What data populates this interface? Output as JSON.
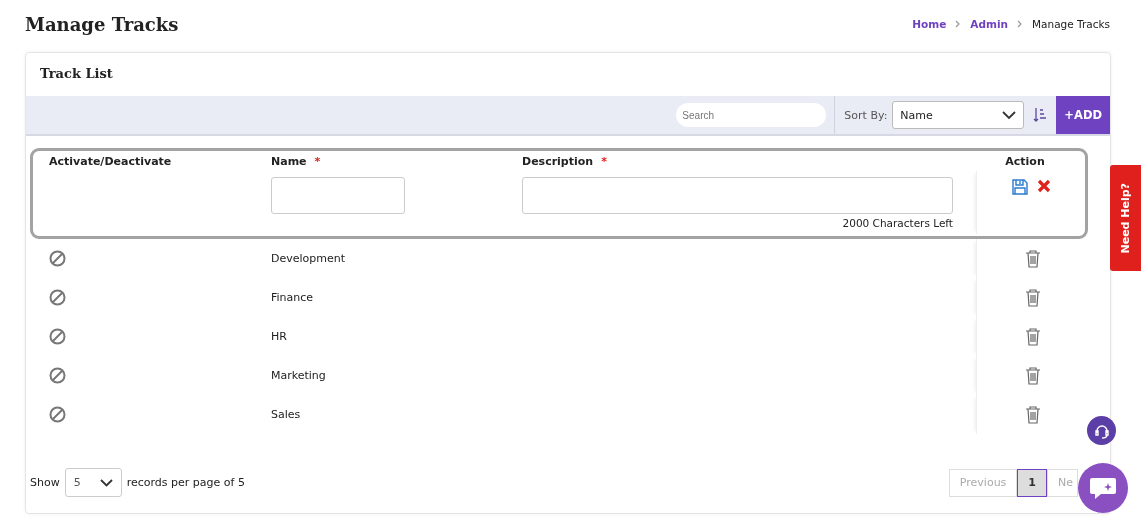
{
  "page_title": "Manage Tracks",
  "breadcrumb": [
    {
      "label": "Home",
      "current": false
    },
    {
      "label": "Admin",
      "current": false
    },
    {
      "label": "Manage Tracks",
      "current": true
    }
  ],
  "card_title": "Track List",
  "toolbar": {
    "search": {
      "placeholder": "Search"
    },
    "sort_label": "Sort By:",
    "sort_value": "Name",
    "add_button": "+ADD"
  },
  "columns": [
    {
      "label": "Activate/Deactivate"
    },
    {
      "label": "Name",
      "required_mark": "*"
    },
    {
      "label": "Description",
      "required_mark": "*"
    },
    {
      "label": "Action"
    }
  ],
  "new_row": {
    "chars_left": "2000 Characters Left"
  },
  "rows": [
    {
      "name": "Development"
    },
    {
      "name": "Finance"
    },
    {
      "name": "HR"
    },
    {
      "name": "Marketing"
    },
    {
      "name": "Sales"
    }
  ],
  "footer": {
    "show_label": "Show",
    "page_size": "5",
    "records_text": "records per page of 5",
    "previous": {
      "label": "Previous",
      "disabled": true
    },
    "pages": [
      {
        "label": "1",
        "selected": true
      }
    ],
    "next": {
      "label": "Ne",
      "disabled": true
    }
  },
  "help_tab": "Need Help?"
}
